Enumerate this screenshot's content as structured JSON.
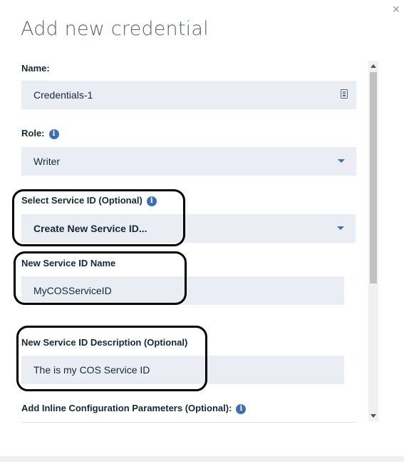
{
  "dialog": {
    "title": "Add new credential",
    "close_label": "×"
  },
  "form": {
    "name_label": "Name:",
    "name_value": "Credentials-1",
    "role_label": "Role:",
    "role_value": "Writer",
    "service_id_label": "Select Service ID (Optional)",
    "service_id_value": "Create New Service ID...",
    "new_service_id_name_label": "New Service ID Name",
    "new_service_id_name_value": "MyCOSServiceID",
    "new_service_id_desc_label": "New Service ID Description (Optional)",
    "new_service_id_desc_value": "The is my COS Service ID",
    "inline_params_label": "Add Inline Configuration Parameters (Optional):",
    "info_glyph": "i"
  },
  "icons": [
    "close-icon",
    "info-icon",
    "id-card-icon",
    "chevron-down-icon"
  ],
  "colors": {
    "field_bg": "#eaeef4",
    "accent": "#3d70b2",
    "title": "#5a6872",
    "annotation": "#000000"
  }
}
